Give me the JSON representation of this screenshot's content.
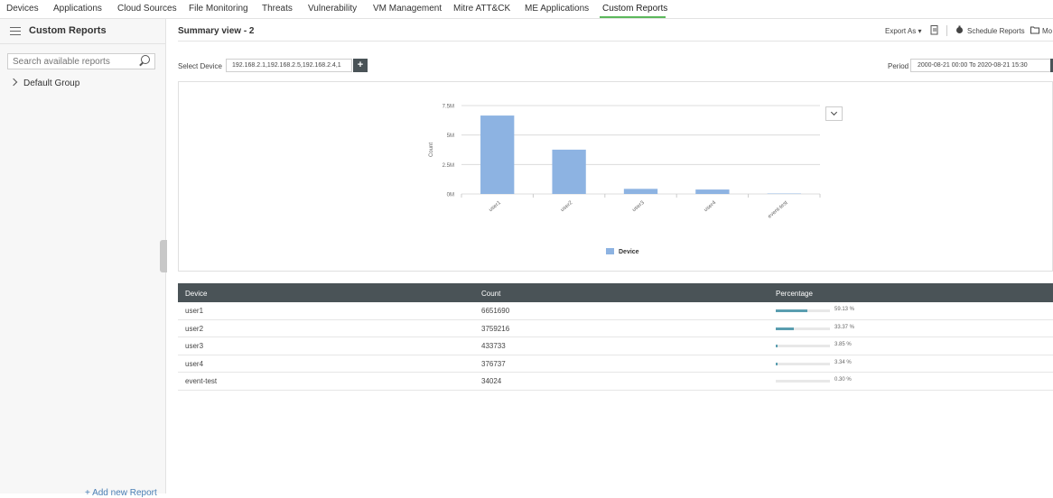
{
  "nav": {
    "tabs": [
      {
        "label": "Devices"
      },
      {
        "label": "Applications"
      },
      {
        "label": "Cloud Sources"
      },
      {
        "label": "File Monitoring"
      },
      {
        "label": "Threats"
      },
      {
        "label": "Vulnerability"
      },
      {
        "label": "VM Management"
      },
      {
        "label": "Mitre ATT&CK"
      },
      {
        "label": "ME Applications"
      },
      {
        "label": "Custom Reports"
      }
    ],
    "active": "Custom Reports",
    "accent_color": "#5cb85c"
  },
  "sidebar": {
    "title": "Custom Reports",
    "search_placeholder": "Search available reports",
    "group": "Default Group",
    "add_report": "+ Add new Report"
  },
  "main": {
    "title": "Summary view - 2",
    "toolbar": {
      "export": "Export As ▾",
      "schedule": "Schedule Reports",
      "more": "Mo"
    },
    "select_device_label": "Select Device",
    "device_value": "192.168.2.1,192.168.2.5,192.168.2.4,1",
    "add_label": "+",
    "period_label": "Period",
    "period_value": "2000-08-21 00:00 To 2020-08-21 15:30"
  },
  "chart_data": {
    "type": "bar",
    "categories": [
      "user1",
      "user2",
      "user3",
      "user4",
      "event-test"
    ],
    "series": [
      {
        "name": "Device",
        "values": [
          6651690,
          3759216,
          433733,
          376737,
          34024
        ]
      }
    ],
    "ylabel": "Count",
    "ylim": [
      0,
      7500000
    ],
    "yticks": [
      {
        "value": 0,
        "label": "0M"
      },
      {
        "value": 2500000,
        "label": "2.5M"
      },
      {
        "value": 5000000,
        "label": "5M"
      },
      {
        "value": 7500000,
        "label": "7.5M"
      }
    ],
    "grid": true,
    "legend": "bottom",
    "bar_color": "#8db3e2"
  },
  "table": {
    "headers": [
      "Device",
      "Count",
      "Percentage"
    ],
    "rows": [
      {
        "device": "user1",
        "count": "6651690",
        "pct": "59.13 %",
        "frac": 0.5913
      },
      {
        "device": "user2",
        "count": "3759216",
        "pct": "33.37 %",
        "frac": 0.3337
      },
      {
        "device": "user3",
        "count": "433733",
        "pct": "3.85 %",
        "frac": 0.0385
      },
      {
        "device": "user4",
        "count": "376737",
        "pct": "3.34 %",
        "frac": 0.0334
      },
      {
        "device": "event-test",
        "count": "34024",
        "pct": "0.30 %",
        "frac": 0.003
      }
    ],
    "bar_color": "#5a9eb0"
  }
}
